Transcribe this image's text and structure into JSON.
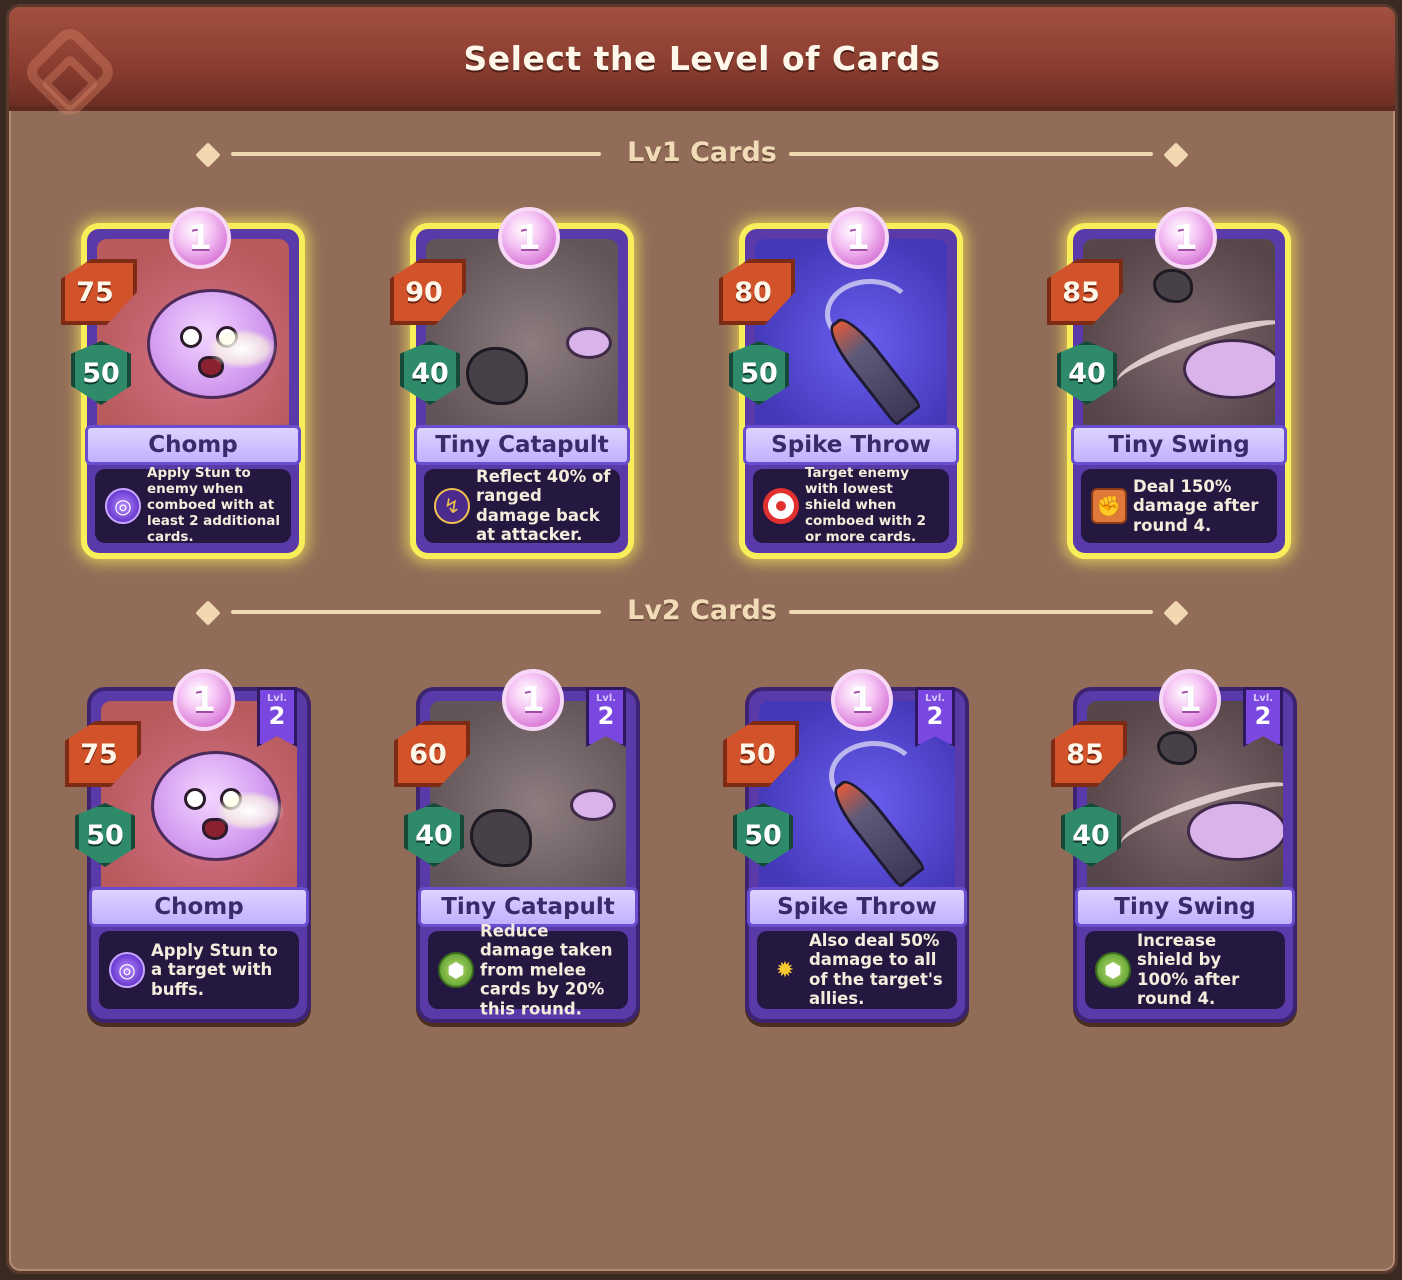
{
  "title": "Select the Level of Cards",
  "sections": [
    {
      "label": "Lv1 Cards",
      "cards": [
        {
          "name": "Chomp",
          "level": "1",
          "cost": "75",
          "shield": "50",
          "description": "Apply Stun to enemy when comboed with at least 2 additional cards.",
          "icon": "spiral-icon",
          "selected": true
        },
        {
          "name": "Tiny Catapult",
          "level": "1",
          "cost": "90",
          "shield": "40",
          "description": "Reflect 40% of ranged damage back at attacker.",
          "icon": "reflect-icon",
          "selected": true
        },
        {
          "name": "Spike Throw",
          "level": "1",
          "cost": "80",
          "shield": "50",
          "description": "Target enemy with lowest shield when comboed with 2 or more cards.",
          "icon": "target-icon",
          "selected": true
        },
        {
          "name": "Tiny Swing",
          "level": "1",
          "cost": "85",
          "shield": "40",
          "description": "Deal 150% damage after round 4.",
          "icon": "fist-icon",
          "selected": true
        }
      ]
    },
    {
      "label": "Lv2 Cards",
      "cards": [
        {
          "name": "Chomp",
          "level": "1",
          "card_level_label": "Lvl.",
          "card_level": "2",
          "cost": "75",
          "shield": "50",
          "description": "Apply Stun to a target with buffs.",
          "icon": "spiral-icon",
          "selected": false
        },
        {
          "name": "Tiny Catapult",
          "level": "1",
          "card_level_label": "Lvl.",
          "card_level": "2",
          "cost": "60",
          "shield": "40",
          "description": "Reduce damage taken from melee cards by 20% this round.",
          "icon": "turtle-shell-icon",
          "selected": false
        },
        {
          "name": "Spike Throw",
          "level": "1",
          "card_level_label": "Lvl.",
          "card_level": "2",
          "cost": "50",
          "shield": "50",
          "description": "Also deal 50% damage to all of the target's allies.",
          "icon": "triple-burst-icon",
          "selected": false
        },
        {
          "name": "Tiny Swing",
          "level": "1",
          "card_level_label": "Lvl.",
          "card_level": "2",
          "cost": "85",
          "shield": "40",
          "description": "Increase shield by 100% after round 4.",
          "icon": "turtle-shell-icon",
          "selected": false
        }
      ]
    }
  ],
  "colors": {
    "selected_border": "#f7ee5a",
    "header": "#8a3d30",
    "panel": "#916c58",
    "cost_badge": "#d2522a",
    "shield_badge": "#2f8a6a"
  }
}
